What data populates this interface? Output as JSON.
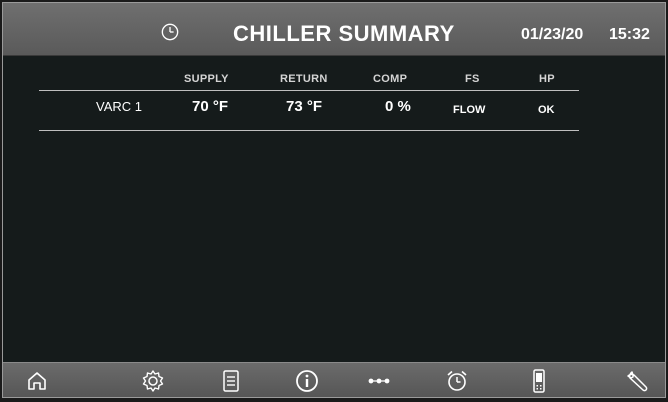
{
  "header": {
    "title": "CHILLER SUMMARY",
    "date": "01/23/20",
    "time": "15:32",
    "icon": "clock-icon"
  },
  "table": {
    "columns": [
      "SUPPLY",
      "RETURN",
      "COMP",
      "FS",
      "HP"
    ],
    "rows": [
      {
        "name": "VARC 1",
        "supply": "70 °F",
        "return": "73 °F",
        "comp": "0 %",
        "fs": "FLOW",
        "hp": "OK"
      }
    ]
  },
  "footer": {
    "buttons": [
      "home-icon",
      "settings-gear-icon",
      "document-icon",
      "info-icon",
      "more-dots-icon",
      "alarm-clock-icon",
      "remote-phone-icon",
      "wrench-icon"
    ]
  },
  "colors": {
    "header_bg": "#5f5f5f",
    "body_bg": "#151b1b",
    "text": "#ffffff",
    "rule": "#bfbfbf"
  }
}
